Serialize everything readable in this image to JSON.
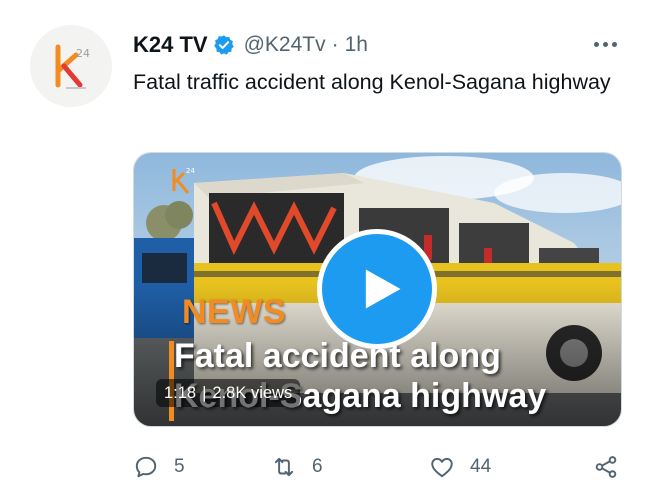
{
  "tweet": {
    "display_name": "K24 TV",
    "handle": "@K24Tv",
    "separator": "·",
    "time": "1h",
    "text": "Fatal traffic accident along Kenol-Sagana highway",
    "avatar_logo_text": "k24",
    "verified": true,
    "colors": {
      "accent": "#1d9bf0",
      "brand_orange": "#f28c20",
      "secondary_text": "#536471"
    }
  },
  "media": {
    "overlay_news": "NEWS",
    "overlay_line1": "Fatal accident along",
    "overlay_line2": "Kenol-Sagana highway",
    "duration": "1:18",
    "views": "2.8K views",
    "watermark": "k24"
  },
  "actions": {
    "reply_count": "5",
    "retweet_count": "6",
    "like_count": "44",
    "icons": [
      "reply-icon",
      "retweet-icon",
      "like-icon",
      "share-icon"
    ]
  }
}
